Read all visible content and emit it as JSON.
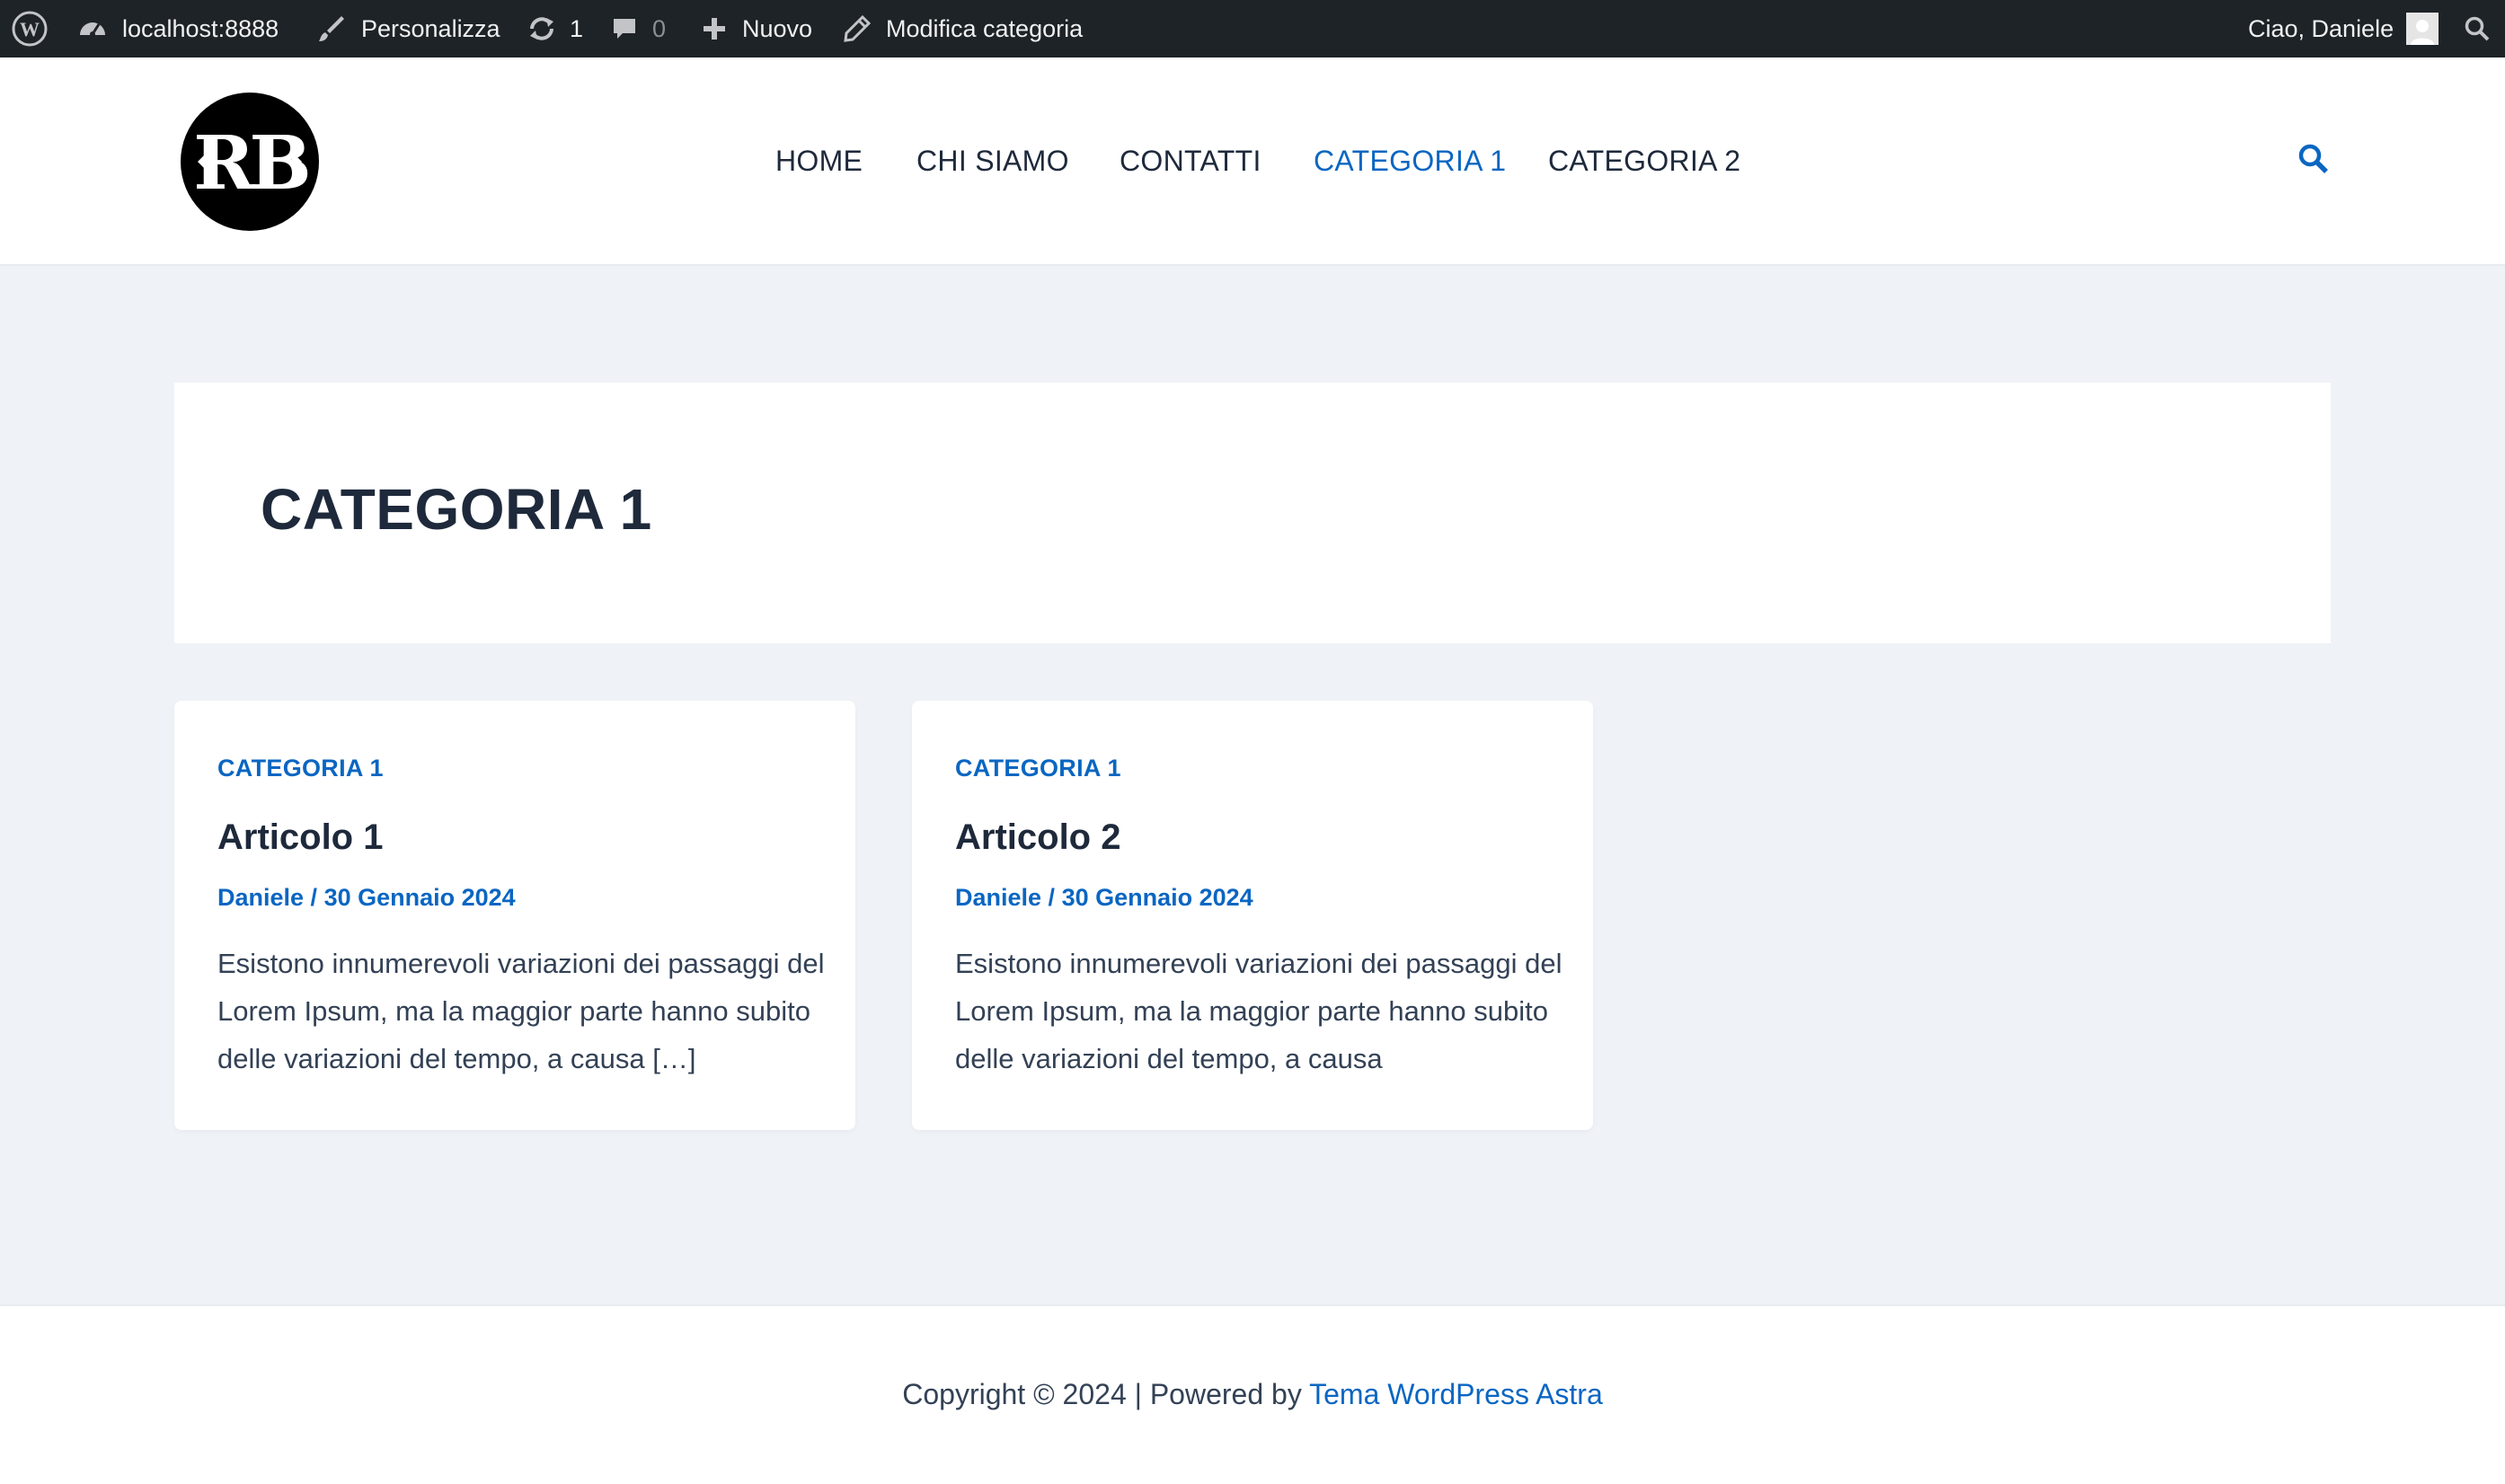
{
  "admin_bar": {
    "site_name": "localhost:8888",
    "customize_label": "Personalizza",
    "updates_count": "1",
    "comments_count": "0",
    "new_label": "Nuovo",
    "edit_label": "Modifica categoria",
    "greeting": "Ciao, Daniele",
    "icons": [
      "wordpress-logo-icon",
      "dashboard-icon",
      "brush-icon",
      "refresh-icon",
      "comment-icon",
      "plus-icon",
      "pencil-icon",
      "avatar",
      "search-icon"
    ]
  },
  "header": {
    "logo_text": "RB",
    "nav": [
      {
        "label": "HOME",
        "active": false
      },
      {
        "label": "CHI SIAMO",
        "active": false
      },
      {
        "label": "CONTATTI",
        "active": false
      },
      {
        "label": "CATEGORIA 1",
        "active": true
      },
      {
        "label": "CATEGORIA 2",
        "active": false
      }
    ]
  },
  "archive": {
    "title": "CATEGORIA 1"
  },
  "posts": [
    {
      "category": "CATEGORIA 1",
      "title": "Articolo 1",
      "author": "Daniele",
      "separator": " / ",
      "date": "30 Gennaio 2024",
      "excerpt": "Esistono innumerevoli variazioni dei passaggi del Lorem Ipsum, ma la maggior parte hanno subito delle variazioni del tempo, a causa […]"
    },
    {
      "category": "CATEGORIA 1",
      "title": "Articolo 2",
      "author": "Daniele",
      "separator": " / ",
      "date": "30 Gennaio 2024",
      "excerpt": "Esistono innumerevoli variazioni dei passaggi del Lorem Ipsum, ma la maggior parte hanno subito delle variazioni del tempo, a causa"
    }
  ],
  "footer": {
    "text": "Copyright © 2024 | Powered by ",
    "link": "Tema WordPress Astra"
  },
  "colors": {
    "accent": "#0a66c2",
    "admin_bar_bg": "#1d2327",
    "page_bg": "#eff3f7",
    "heading": "#1e293b"
  }
}
